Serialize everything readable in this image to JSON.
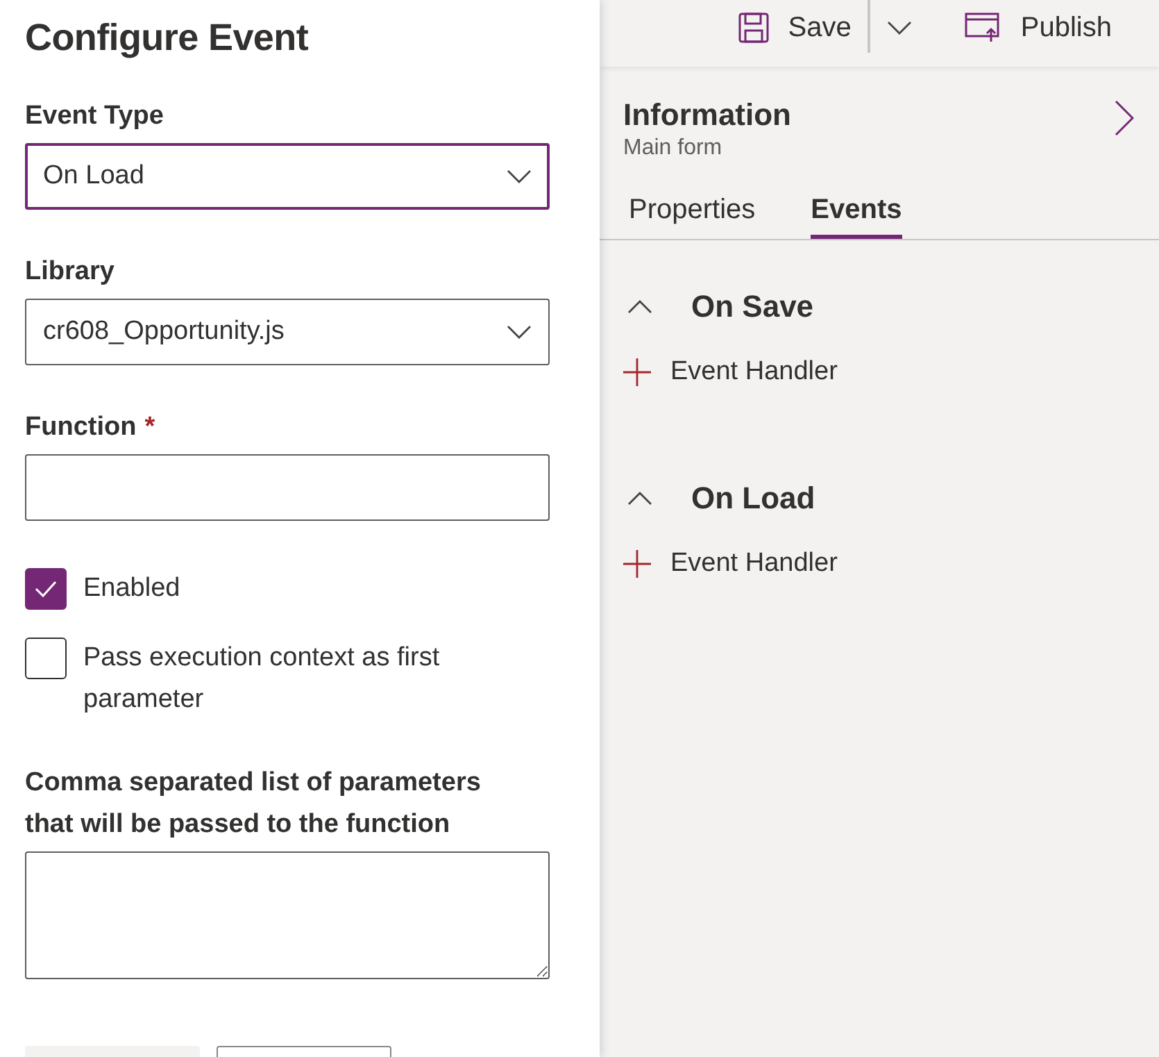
{
  "configure_panel": {
    "title": "Configure Event",
    "fields": [
      {
        "kind": "dropdown",
        "label": "Event Type",
        "value": "On Load",
        "focused": true
      },
      {
        "kind": "dropdown",
        "label": "Library",
        "value": "cr608_Opportunity.js",
        "focused": false
      },
      {
        "kind": "text",
        "label": "Function",
        "required_mark": "*",
        "focused": false
      }
    ],
    "checkboxes": [
      {
        "label": "Enabled",
        "checked": true
      },
      {
        "label": "Pass execution context as first parameter",
        "checked": false
      }
    ],
    "parameters": {
      "label": "Comma separated list of parameters that will be passed to the function"
    },
    "footer_buttons": [
      {
        "kind": "primary"
      },
      {
        "kind": "secondary"
      }
    ]
  },
  "toolbar": {
    "items": [
      {
        "kind": "save",
        "label": "Save"
      },
      {
        "kind": "dropdown"
      },
      {
        "kind": "publish",
        "label": "Publish"
      }
    ]
  },
  "properties_panel": {
    "title": "Information",
    "subtitle": "Main form",
    "tabs": [
      {
        "label": "Properties",
        "selected": false
      },
      {
        "label": "Events",
        "selected": true
      }
    ],
    "sections": [
      {
        "title": "On Save",
        "expanded": true,
        "action": "Event Handler"
      },
      {
        "title": "On Load",
        "expanded": true,
        "action": "Event Handler"
      }
    ]
  }
}
